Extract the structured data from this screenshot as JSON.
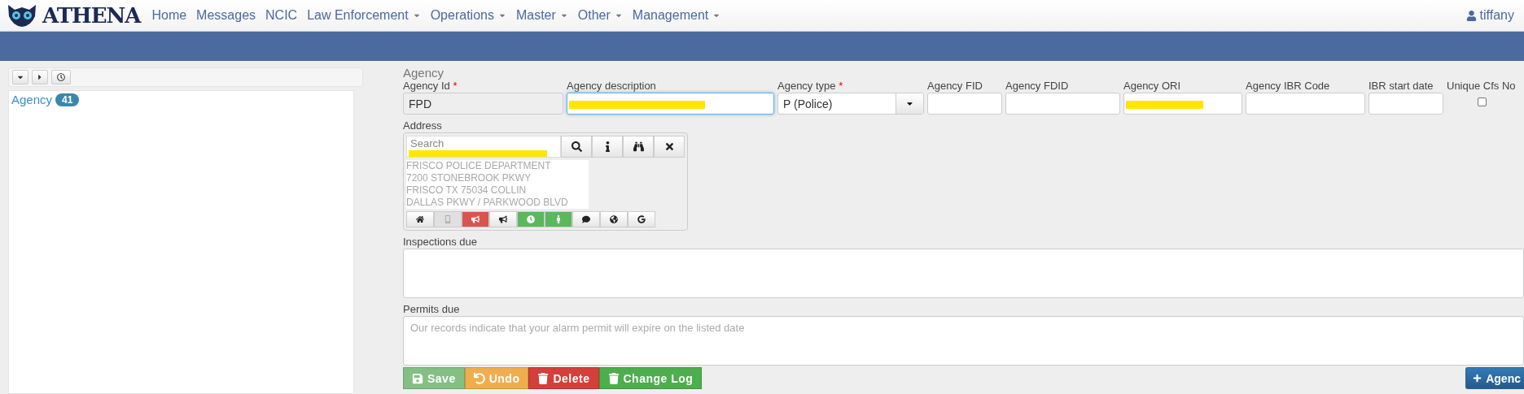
{
  "brand": "ATHENA",
  "nav": [
    {
      "label": "Home",
      "dropdown": false
    },
    {
      "label": "Messages",
      "dropdown": false
    },
    {
      "label": "NCIC",
      "dropdown": false
    },
    {
      "label": "Law Enforcement",
      "dropdown": true
    },
    {
      "label": "Operations",
      "dropdown": true
    },
    {
      "label": "Master",
      "dropdown": true
    },
    {
      "label": "Other",
      "dropdown": true
    },
    {
      "label": "Management",
      "dropdown": true
    }
  ],
  "user": "tiffany",
  "tree": {
    "items": [
      {
        "label": "Agency",
        "count": "41"
      }
    ]
  },
  "form": {
    "title": "Agency",
    "fields": [
      {
        "kind": "text",
        "label": "Agency Id",
        "marker": "*",
        "value": "FPD",
        "disabled": true,
        "redacted": false,
        "focused": false
      },
      {
        "kind": "text",
        "label": "Agency description",
        "disabled": false,
        "redacted": true,
        "focused": true
      },
      {
        "kind": "select",
        "label": "Agency type",
        "marker": "*",
        "value": "P (Police)"
      },
      {
        "kind": "text",
        "label": "Agency FID",
        "disabled": false,
        "redacted": false,
        "focused": false
      },
      {
        "kind": "text",
        "label": "Agency FDID",
        "disabled": false,
        "redacted": false,
        "focused": false
      },
      {
        "kind": "text",
        "label": "Agency ORI",
        "disabled": false,
        "redacted": true,
        "focused": false
      },
      {
        "kind": "text",
        "label": "Agency IBR Code",
        "disabled": false,
        "redacted": false,
        "focused": false
      },
      {
        "kind": "text",
        "label": "IBR start date",
        "disabled": false,
        "redacted": false,
        "focused": false
      },
      {
        "kind": "checkbox",
        "label": "Unique Cfs No",
        "checked": false
      }
    ],
    "address": {
      "label": "Address",
      "search_placeholder": "Search",
      "search_redacted": true,
      "lines": [
        "FRISCO POLICE DEPARTMENT",
        "7200 STONEBROOK PKWY",
        "FRISCO TX 75034 COLLIN",
        "DALLAS PKWY / PARKWOOD BLVD"
      ],
      "tools": [
        {
          "kind": "default"
        },
        {
          "kind": "pressed"
        },
        {
          "kind": "danger"
        },
        {
          "kind": "default"
        },
        {
          "kind": "success"
        },
        {
          "kind": "success"
        },
        {
          "kind": "default"
        },
        {
          "kind": "default"
        },
        {
          "kind": "default"
        }
      ]
    },
    "inspections": {
      "label": "Inspections due"
    },
    "permits": {
      "label": "Permits due",
      "placeholder": "Our records indicate that your alarm permit will expire on the listed date"
    },
    "actions": [
      {
        "kind": "save",
        "label": "Save"
      },
      {
        "kind": "undo",
        "label": "Undo"
      },
      {
        "kind": "delete",
        "label": "Delete"
      },
      {
        "kind": "log",
        "label": "Change Log"
      }
    ],
    "add_button": "Agenc"
  }
}
